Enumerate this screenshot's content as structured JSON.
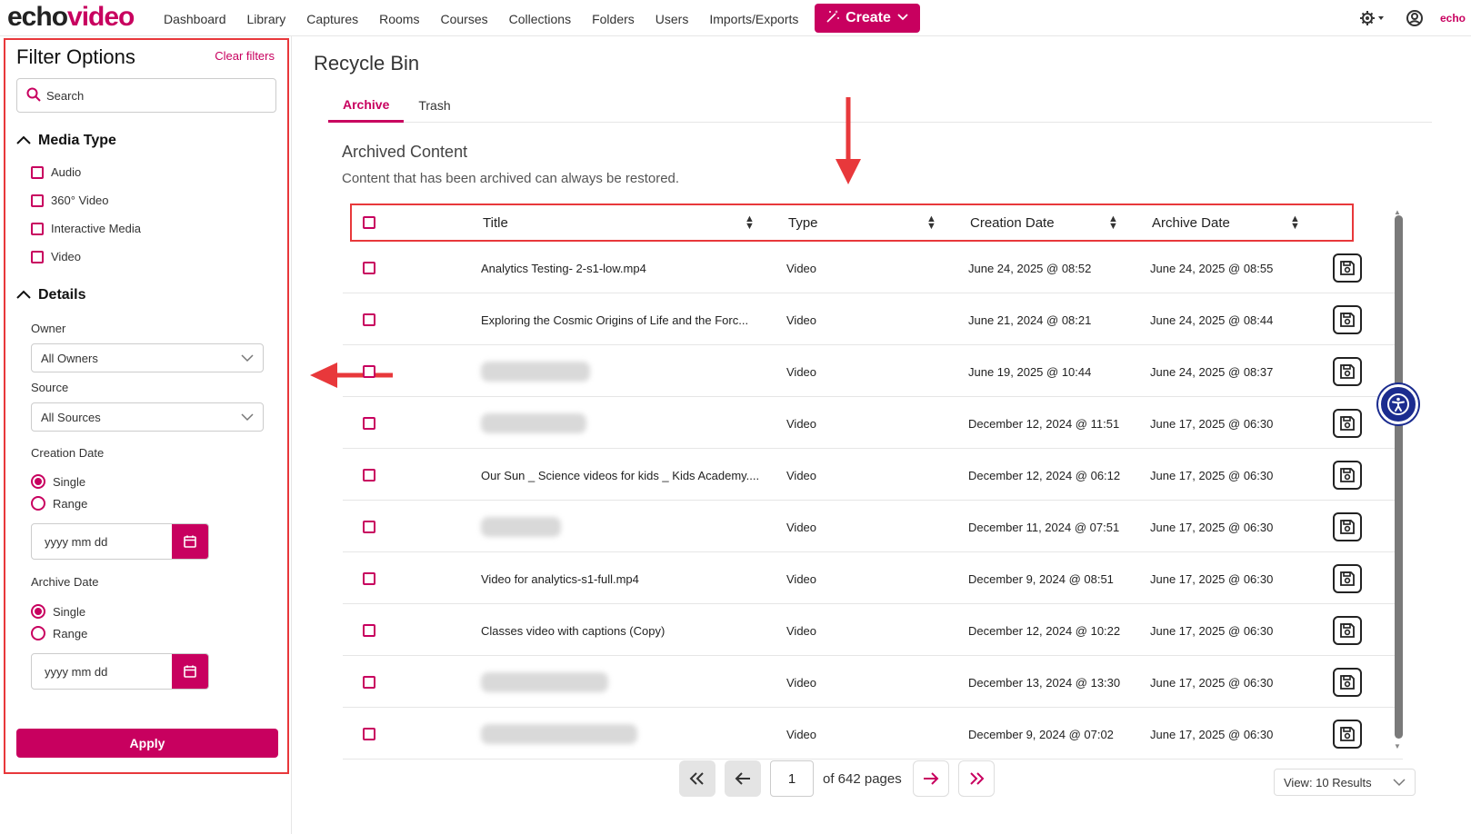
{
  "app": {
    "logo_part1": "echo",
    "logo_part2": "video",
    "mini_logo": "echo"
  },
  "nav": {
    "items": [
      "Dashboard",
      "Library",
      "Captures",
      "Rooms",
      "Courses",
      "Collections",
      "Folders",
      "Users",
      "Imports/Exports"
    ],
    "create_label": "Create"
  },
  "filters": {
    "title": "Filter Options",
    "clear_label": "Clear filters",
    "search_placeholder": "Search",
    "media_type": {
      "heading": "Media Type",
      "options": [
        "Audio",
        "360° Video",
        "Interactive Media",
        "Video"
      ]
    },
    "details": {
      "heading": "Details",
      "owner_label": "Owner",
      "owner_value": "All Owners",
      "source_label": "Source",
      "source_value": "All Sources",
      "creation_date_label": "Creation Date",
      "archive_date_label": "Archive Date",
      "single_label": "Single",
      "range_label": "Range",
      "date_placeholder": "yyyy mm dd"
    },
    "apply_label": "Apply"
  },
  "main": {
    "page_title": "Recycle Bin",
    "tabs": [
      "Archive",
      "Trash"
    ],
    "section_title": "Archived Content",
    "section_desc": "Content that has been archived can always be restored.",
    "columns": [
      "Title",
      "Type",
      "Creation Date",
      "Archive Date"
    ],
    "rows": [
      {
        "title": "Analytics Testing- 2-s1-low.mp4",
        "type": "Video",
        "created": "June 24, 2025 @ 08:52",
        "archived": "June 24, 2025 @ 08:55",
        "blurred": false
      },
      {
        "title": "Exploring the Cosmic Origins of Life and the Forc...",
        "type": "Video",
        "created": "June 21, 2024 @ 08:21",
        "archived": "June 24, 2025 @ 08:44",
        "blurred": false
      },
      {
        "title": "",
        "type": "Video",
        "created": "June 19, 2025 @ 10:44",
        "archived": "June 24, 2025 @ 08:37",
        "blurred": true
      },
      {
        "title": "",
        "type": "Video",
        "created": "December 12, 2024 @ 11:51",
        "archived": "June 17, 2025 @ 06:30",
        "blurred": true
      },
      {
        "title": "Our Sun _ Science videos for kids _ Kids Academy....",
        "type": "Video",
        "created": "December 12, 2024 @ 06:12",
        "archived": "June 17, 2025 @ 06:30",
        "blurred": false
      },
      {
        "title": "",
        "type": "Video",
        "created": "December 11, 2024 @ 07:51",
        "archived": "June 17, 2025 @ 06:30",
        "blurred": true
      },
      {
        "title": "Video for analytics-s1-full.mp4",
        "type": "Video",
        "created": "December 9, 2024 @ 08:51",
        "archived": "June 17, 2025 @ 06:30",
        "blurred": false
      },
      {
        "title": "Classes video with captions (Copy)",
        "type": "Video",
        "created": "December 12, 2024 @ 10:22",
        "archived": "June 17, 2025 @ 06:30",
        "blurred": false
      },
      {
        "title": "",
        "type": "Video",
        "created": "December 13, 2024 @ 13:30",
        "archived": "June 17, 2025 @ 06:30",
        "blurred": true
      },
      {
        "title": "",
        "type": "Video",
        "created": "December 9, 2024 @ 07:02",
        "archived": "June 17, 2025 @ 06:30",
        "blurred": true
      }
    ]
  },
  "pager": {
    "page": "1",
    "of_pages": "of 642 pages",
    "view_label": "View: 10 Results"
  }
}
